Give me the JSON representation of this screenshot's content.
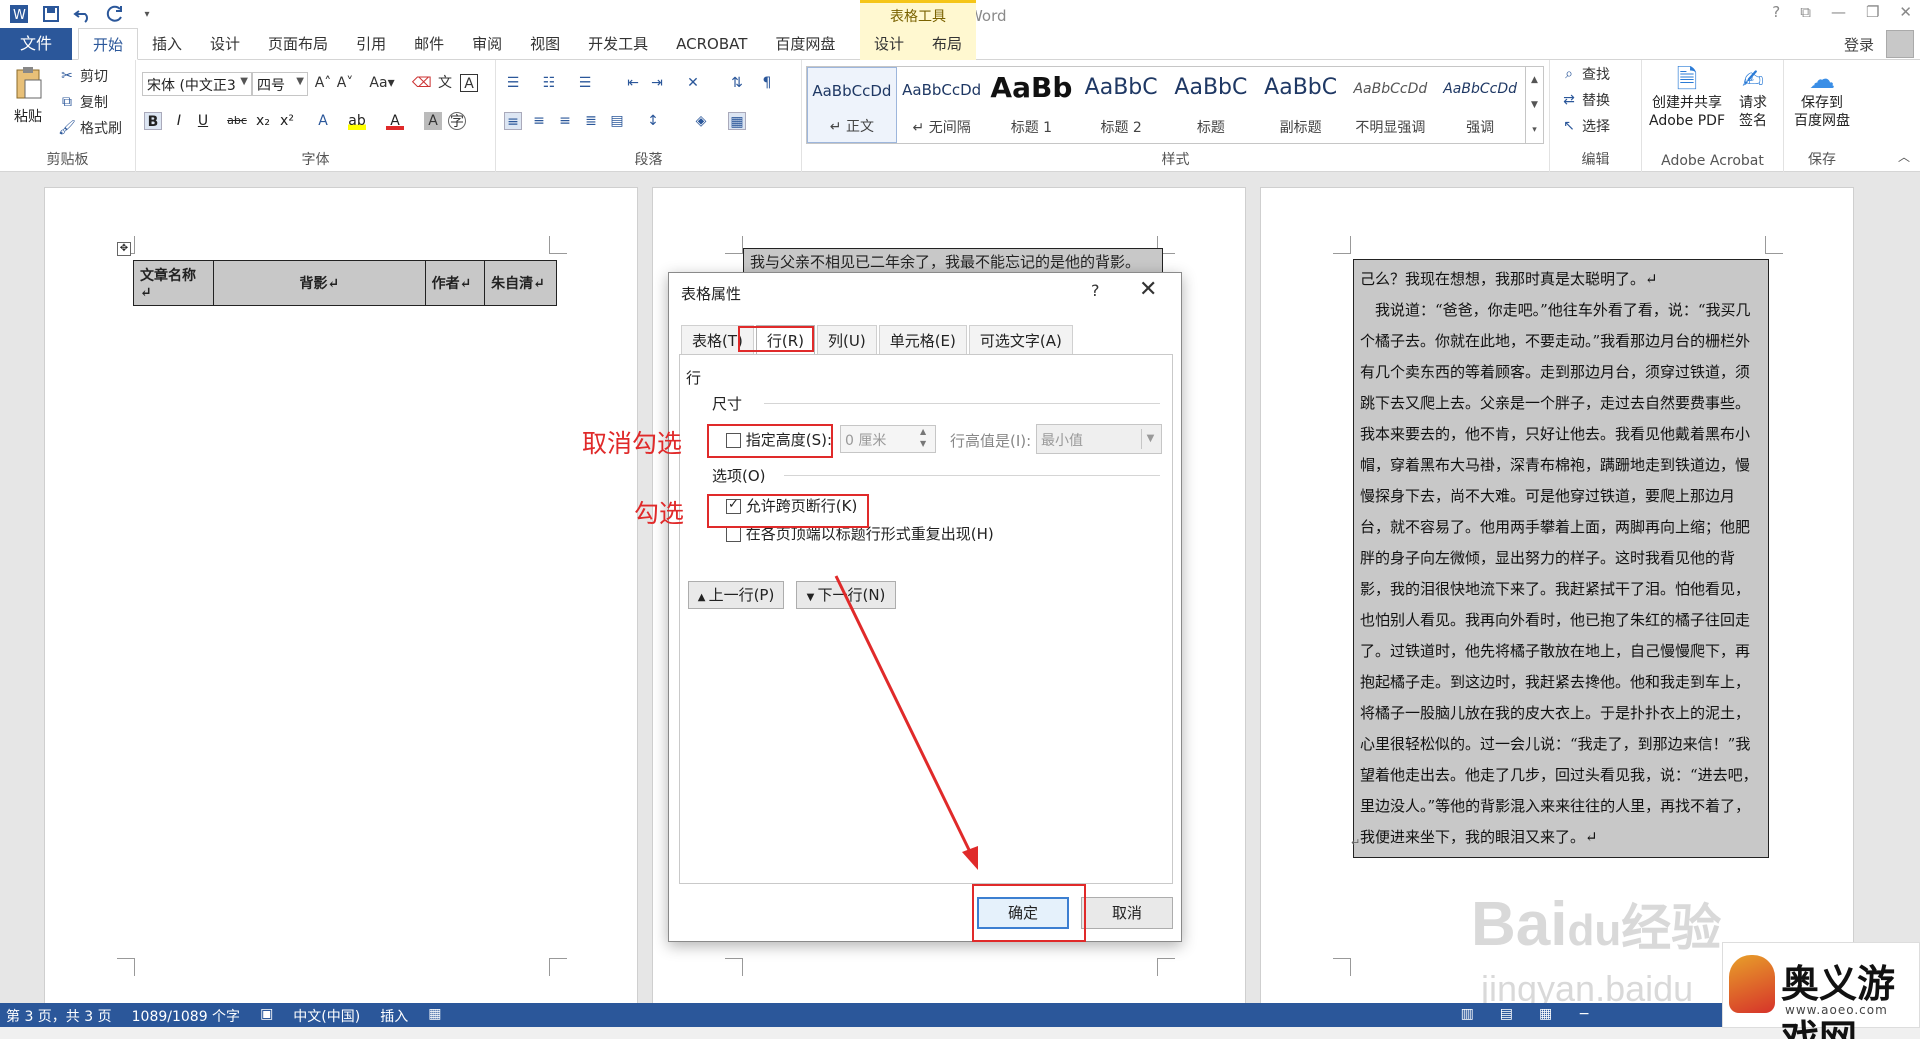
{
  "titlebar": {
    "title": "文档2 - Word",
    "context_header": "表格工具",
    "help": "?",
    "restore": "⧉",
    "minimize": "—",
    "maximize": "❐",
    "close": "✕"
  },
  "tabs": {
    "file": "文件",
    "items": [
      "开始",
      "插入",
      "设计",
      "页面布局",
      "引用",
      "邮件",
      "审阅",
      "视图",
      "开发工具",
      "ACROBAT",
      "百度网盘"
    ],
    "context_items": [
      "设计",
      "布局"
    ],
    "login": "登录"
  },
  "ribbon": {
    "clipboard": {
      "label": "剪贴板",
      "paste": "粘贴",
      "cut": "剪切",
      "copy": "复制",
      "format_painter": "格式刷"
    },
    "font": {
      "label": "字体",
      "font_name": "宋体 (中文正3",
      "font_size": "四号",
      "bold": "B",
      "italic": "I",
      "underline": "U",
      "strike": "abc",
      "sub": "x₂",
      "sup": "x²"
    },
    "paragraph": {
      "label": "段落"
    },
    "styles": {
      "label": "样式",
      "items": [
        {
          "sample": "AaBbCcDd",
          "name": "↵ 正文"
        },
        {
          "sample": "AaBbCcDd",
          "name": "↵ 无间隔"
        },
        {
          "sample": "AaBb",
          "name": "标题 1"
        },
        {
          "sample": "AaBbC",
          "name": "标题 2"
        },
        {
          "sample": "AaBbC",
          "name": "标题"
        },
        {
          "sample": "AaBbC",
          "name": "副标题"
        },
        {
          "sample": "AaBbCcDd",
          "name": "不明显强调"
        },
        {
          "sample": "AaBbCcDd",
          "name": "强调"
        }
      ]
    },
    "editing": {
      "label": "编辑",
      "find": "查找",
      "replace": "替换",
      "select": "选择"
    },
    "acrobat": {
      "label": "Adobe Acrobat",
      "create_pdf": "创建并共享",
      "create_pdf_2": "Adobe PDF",
      "request_sign": "请求",
      "request_sign_2": "签名"
    },
    "save": {
      "label": "保存",
      "save_to": "保存到",
      "save_to_2": "百度网盘"
    }
  },
  "doc": {
    "table_cells": [
      "文章名称↵",
      "背影↵",
      "作者↵",
      "朱自清↵"
    ],
    "page2_snippet": "我与父亲不相见已二年余了，我最不能忘记的是他的背影。",
    "page3_paragraphs": [
      "己么？我现在想想，我那时真是太聪明了。↵",
      "　我说道：“爸爸，你走吧。”他往车外看了看，说：“我买几个橘子去。你就在此地，不要走动。”我看那边月台的栅栏外有几个卖东西的等着顾客。走到那边月台，须穿过铁道，须跳下去又爬上去。父亲是一个胖子，走过去自然要费事些。我本来要去的，他不肯，只好让他去。我看见他戴着黑布小帽，穿着黑布大马褂，深青布棉袍，蹒跚地走到铁道边，慢慢探身下去，尚不大难。可是他穿过铁道，要爬上那边月台，就不容易了。他用两手攀着上面，两脚再向上缩；他肥胖的身子向左微倾，显出努力的样子。这时我看见他的背影，我的泪很快地流下来了。我赶紧拭干了泪。怕他看见，也怕别人看见。我再向外看时，他已抱了朱红的橘子往回走了。过铁道时，他先将橘子散放在地上，自己慢慢爬下，再抱起橘子走。到这边时，我赶紧去搀他。他和我走到车上，将橘子一股脑儿放在我的皮大衣上。于是扑扑衣上的泥土，心里很轻松似的。过一会儿说：“我走了，到那边来信！”我望着他走出去。他走了几步，回过头看见我，说：“进去吧，里边没人。”等他的背影混入来来往往的人里，再找不着了，我便进来坐下，我的眼泪又来了。↵"
    ],
    "end_mark": "↵"
  },
  "dialog": {
    "title": "表格属性",
    "help": "?",
    "tabs": [
      "表格(T)",
      "行(R)",
      "列(U)",
      "单元格(E)",
      "可选文字(A)"
    ],
    "section_row": "行",
    "section_size": "尺寸",
    "specify_height": "指定高度(S):",
    "height_value": "0 厘米",
    "row_height_is": "行高值是(I):",
    "row_height_mode": "最小值",
    "section_options": "选项(O)",
    "allow_break": "允许跨页断行(K)",
    "repeat_header": "在各页顶端以标题行形式重复出现(H)",
    "prev_row": "上一行(P)",
    "next_row": "下一行(N)",
    "ok": "确定",
    "cancel": "取消",
    "specify_height_checked": false,
    "allow_break_checked": true,
    "repeat_header_checked": false
  },
  "annotations": {
    "uncheck": "取消勾选",
    "check": "勾选"
  },
  "statusbar": {
    "page": "第 3 页，共 3 页",
    "words": "1089/1089 个字",
    "lang": "中文(中国)",
    "mode": "插入"
  },
  "watermark": {
    "logo": "Bai",
    "logo_2": "du",
    "logo_cn": "经验",
    "url": "jingyan.baidu"
  },
  "brand": {
    "name": "奥义游戏网",
    "url": "www.aoeo.com"
  },
  "colors": {
    "accent": "#2b579a",
    "annotation": "#e02a2a",
    "context_tab": "#fff8d0"
  }
}
